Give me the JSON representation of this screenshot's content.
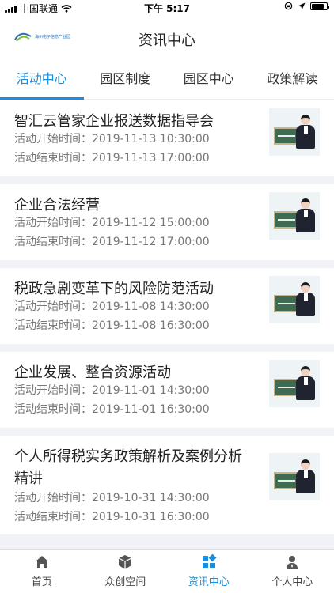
{
  "status_bar": {
    "carrier": "中国联通",
    "time": "下午 5:17",
    "battery_level": 0.85
  },
  "header": {
    "logo_text": "海州电子信息产业园",
    "title": "资讯中心"
  },
  "tabs": [
    {
      "label": "活动中心",
      "active": true
    },
    {
      "label": "园区制度",
      "active": false
    },
    {
      "label": "园区中心",
      "active": false
    },
    {
      "label": "政策解读",
      "active": false
    }
  ],
  "start_label": "活动开始时间：",
  "end_label": "活动结束时间：",
  "activities": [
    {
      "title": "智汇云管家企业报送数据指导会",
      "start": "2019-11-13 10:30:00",
      "end": "2019-11-13 17:00:00"
    },
    {
      "title": "企业合法经营",
      "start": "2019-11-12 15:00:00",
      "end": "2019-11-12 17:00:00"
    },
    {
      "title": "税政急剧变革下的风险防范活动",
      "start": "2019-11-08 14:30:00",
      "end": "2019-11-08 16:30:00"
    },
    {
      "title": "企业发展、整合资源活动",
      "start": "2019-11-01 14:30:00",
      "end": "2019-11-01 16:30:00"
    },
    {
      "title": "个人所得税实务政策解析及案例分析精讲",
      "start": "2019-10-31 14:30:00",
      "end": "2019-10-31 16:30:00"
    }
  ],
  "bottom_nav": [
    {
      "label": "首页",
      "icon": "home-icon",
      "active": false
    },
    {
      "label": "众创空间",
      "icon": "cube-icon",
      "active": false
    },
    {
      "label": "资讯中心",
      "icon": "grid-icon",
      "active": true
    },
    {
      "label": "个人中心",
      "icon": "person-icon",
      "active": false
    }
  ],
  "colors": {
    "accent": "#1a8fe0",
    "background": "#f1f2f5"
  }
}
